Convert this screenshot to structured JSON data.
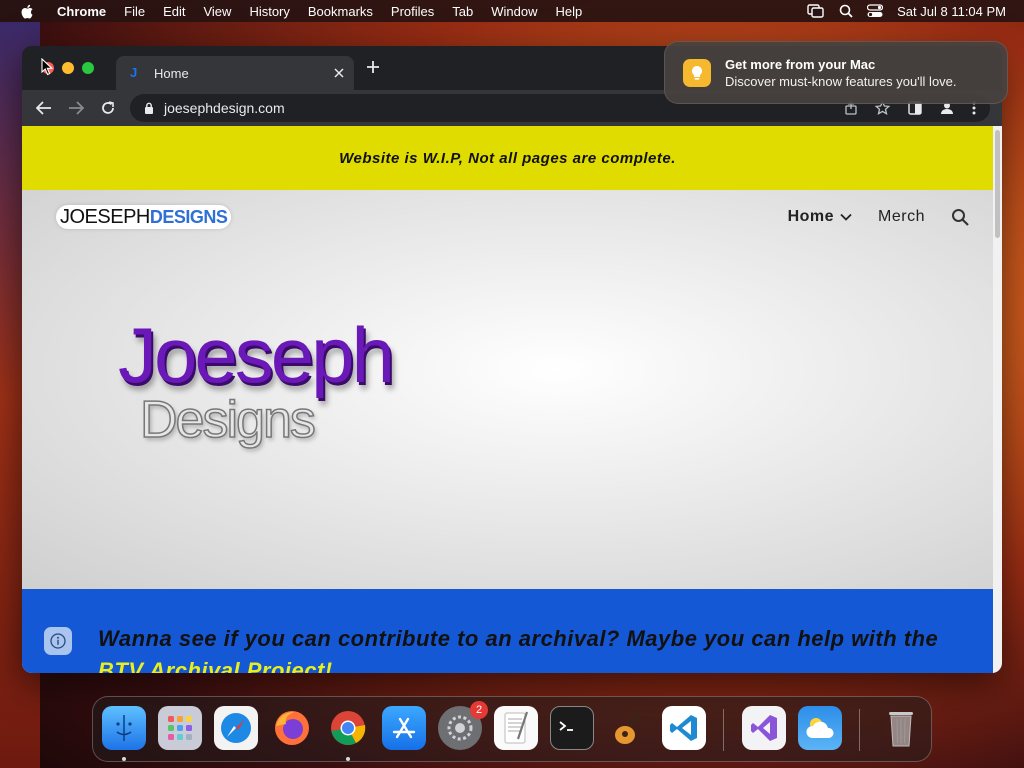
{
  "menubar": {
    "app_name": "Chrome",
    "items": [
      "File",
      "Edit",
      "View",
      "History",
      "Bookmarks",
      "Profiles",
      "Tab",
      "Window",
      "Help"
    ],
    "datetime": "Sat Jul 8  11:04 PM"
  },
  "notification": {
    "title": "Get more from your Mac",
    "body": "Discover must-know features you'll love."
  },
  "browser": {
    "tab_title": "Home",
    "tab_favicon": "J",
    "url": "joesephdesign.com"
  },
  "site": {
    "banner": "Website is W.I.P, Not all pages are complete.",
    "logo_part1": "JOESEPH",
    "logo_part2": "DESIGNS",
    "nav_home": "Home",
    "nav_merch": "Merch",
    "hero_line1": "Joeseph",
    "hero_line2": "Designs",
    "blue_text_start": "Wanna see if you can contribute to an archival? Maybe you can help with the ",
    "blue_text_highlight": "BTV Archival Project!"
  },
  "dock": {
    "apps": [
      "finder-icon",
      "launchpad-icon",
      "safari-icon",
      "firefox-icon",
      "chrome-icon",
      "app-store-icon",
      "system-settings-icon",
      "textedit-icon",
      "terminal-icon",
      "garageband-icon",
      "vscode-icon",
      "visual-studio-icon",
      "weather-icon",
      "trash-icon"
    ],
    "settings_badge": "2"
  },
  "colors": {
    "banner_yellow": "#e1dc00",
    "section_blue": "#1558d6",
    "hero_purple": "#6a18b8",
    "logo_blue": "#2f6fd6"
  }
}
